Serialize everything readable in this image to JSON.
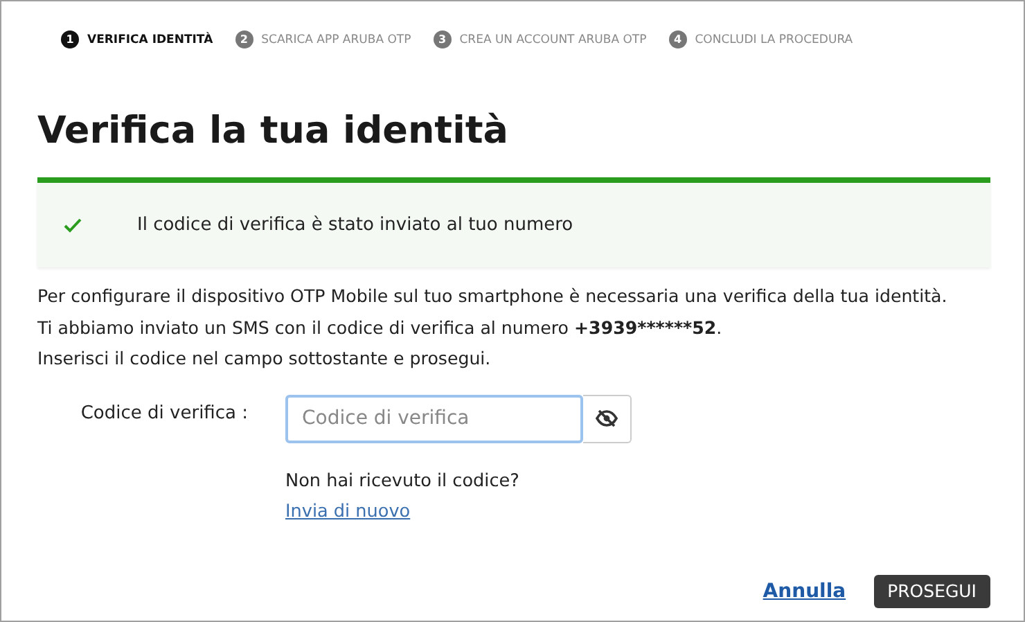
{
  "steps": [
    {
      "number": "1",
      "label": "VERIFICA IDENTITÀ",
      "selected": true
    },
    {
      "number": "2",
      "label": "SCARICA APP ARUBA OTP",
      "selected": false
    },
    {
      "number": "3",
      "label": "CREA UN ACCOUNT ARUBA OTP",
      "selected": false
    },
    {
      "number": "4",
      "label": "CONCLUDI LA PROCEDURA",
      "selected": false
    }
  ],
  "title": "Verifica la tua identità",
  "alert": {
    "kind": "success",
    "message": "Il codice di verifica è stato inviato al tuo numero"
  },
  "intro": [
    {
      "text": "Per configurare il dispositivo OTP Mobile sul tuo smartphone è necessaria una verifica della tua identità."
    },
    {
      "text": "Ti abbiamo inviato un SMS con il codice di verifica al numero ",
      "bold": "+3939******52",
      "after": "."
    },
    {
      "text": "Inserisci il codice nel campo sottostante e prosegui."
    }
  ],
  "form": {
    "label": "Codice di verifica :",
    "placeholder": "Codice di verifica"
  },
  "resend": {
    "text": "Non hai ricevuto il codice?",
    "link": "Invia di nuovo"
  },
  "buttons": {
    "cancel": "Annulla",
    "next": "PROSEGUI"
  }
}
